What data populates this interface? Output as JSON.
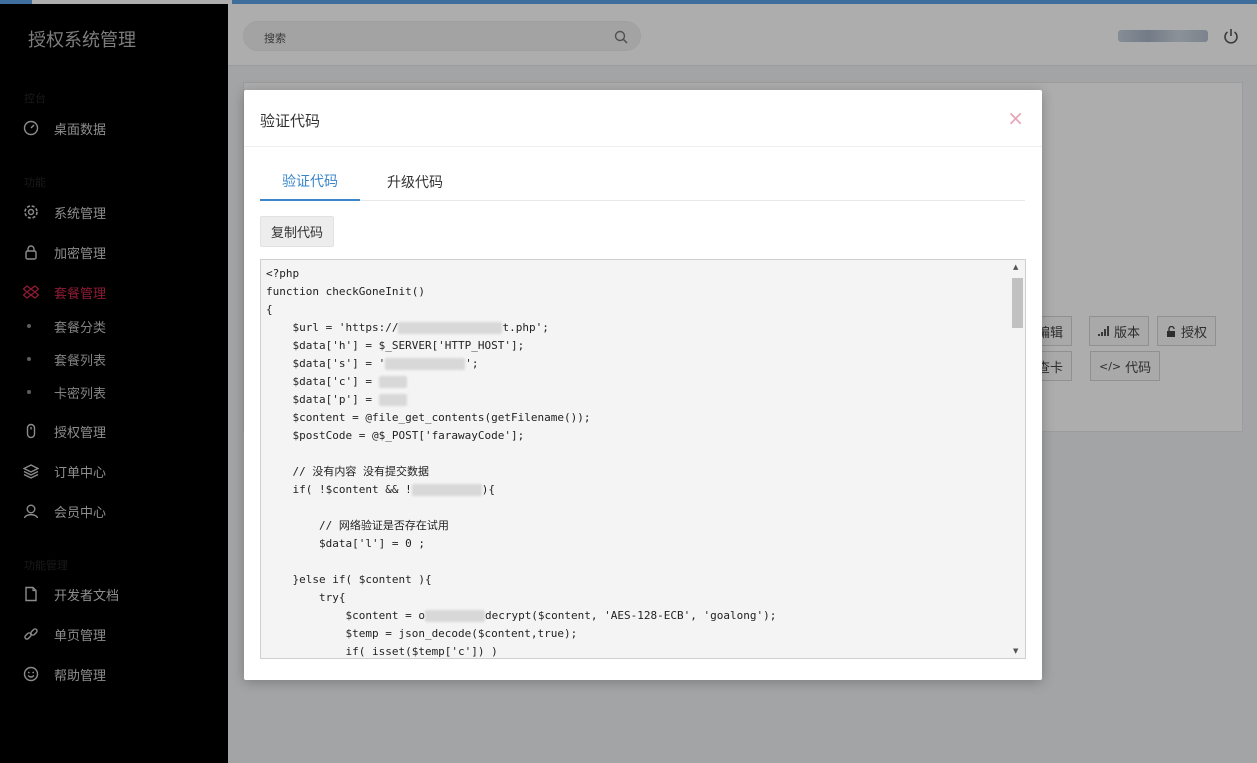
{
  "app": {
    "brand": "授权系统管理"
  },
  "sidebar": {
    "sections": [
      "控台",
      "功能",
      "功能管理"
    ],
    "items": [
      {
        "label": "桌面数据",
        "icon": "dashboard-icon"
      },
      {
        "label": "系统管理",
        "icon": "gear-icon"
      },
      {
        "label": "加密管理",
        "icon": "lock-icon"
      },
      {
        "label": "套餐管理",
        "icon": "dropbox-icon",
        "active": true
      },
      {
        "label": "授权管理",
        "icon": "mouse-icon"
      },
      {
        "label": "订单中心",
        "icon": "layers-icon"
      },
      {
        "label": "会员中心",
        "icon": "user-icon"
      },
      {
        "label": "开发者文档",
        "icon": "file-icon"
      },
      {
        "label": "单页管理",
        "icon": "link-icon"
      },
      {
        "label": "帮助管理",
        "icon": "smile-icon"
      }
    ],
    "sub_items": [
      "套餐分类",
      "套餐列表",
      "卡密列表"
    ],
    "active_color": "#d0284f"
  },
  "header": {
    "search_placeholder": "搜索"
  },
  "background": {
    "buttons_row1": [
      "编辑",
      "版本",
      "授权"
    ],
    "buttons_row2": [
      "查卡",
      "代码"
    ]
  },
  "modal": {
    "title": "验证代码",
    "close": "×",
    "tabs": [
      {
        "label": "验证代码",
        "active": true
      },
      {
        "label": "升级代码",
        "active": false
      }
    ],
    "copy_button": "复制代码",
    "accent_color": "#3a86c8",
    "code": [
      "<?php",
      "function checkGoneInit()",
      "{",
      "    $url = 'https://[blur:104]t.php';",
      "    $data['h'] = $_SERVER['HTTP_HOST'];",
      "    $data['s'] = '[blur:80]';",
      "    $data['c'] = [blur:28]",
      "    $data['p'] = [blur:28]",
      "    $content = @file_get_contents(getFilename());",
      "    $postCode = @$_POST['farawayCode'];",
      "",
      "    // 没有内容 没有提交数据",
      "    if( !$content && ![blur:70]){",
      "",
      "        // 网络验证是否存在试用",
      "        $data['l'] = 0 ;",
      "",
      "    }else if( $content ){",
      "        try{",
      "            $content = o[blur:60]decrypt($content, 'AES-128-ECB', 'goalong');",
      "            $temp = json_decode($content,true);",
      "            if( isset($temp['c']) )"
    ]
  }
}
